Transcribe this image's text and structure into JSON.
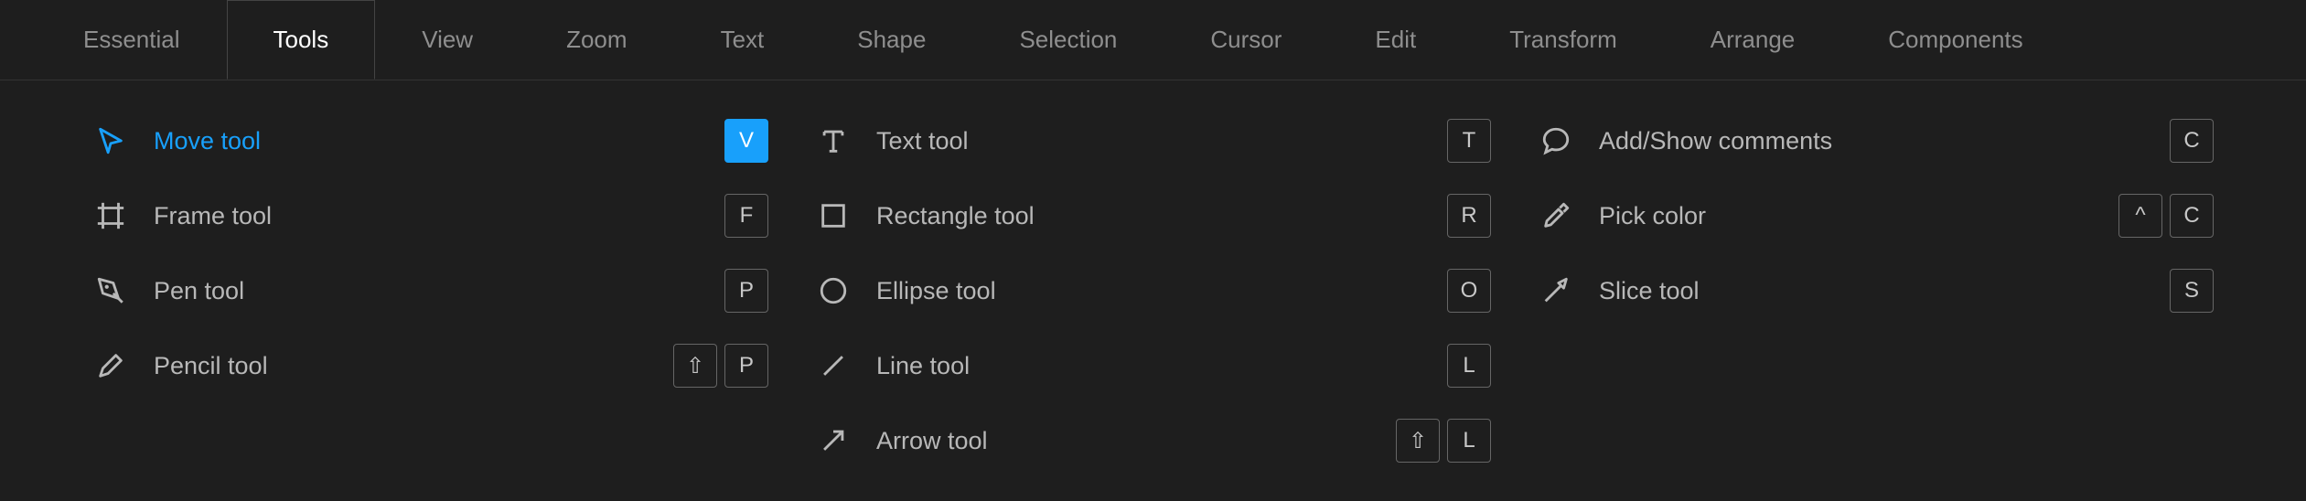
{
  "tabs": [
    {
      "label": "Essential",
      "active": false
    },
    {
      "label": "Tools",
      "active": true
    },
    {
      "label": "View",
      "active": false
    },
    {
      "label": "Zoom",
      "active": false
    },
    {
      "label": "Text",
      "active": false
    },
    {
      "label": "Shape",
      "active": false
    },
    {
      "label": "Selection",
      "active": false
    },
    {
      "label": "Cursor",
      "active": false
    },
    {
      "label": "Edit",
      "active": false
    },
    {
      "label": "Transform",
      "active": false
    },
    {
      "label": "Arrange",
      "active": false
    },
    {
      "label": "Components",
      "active": false
    }
  ],
  "columns": [
    [
      {
        "icon": "move",
        "label": "Move tool",
        "selected": true,
        "keys": [
          {
            "k": "V",
            "active": true
          }
        ]
      },
      {
        "icon": "frame",
        "label": "Frame tool",
        "selected": false,
        "keys": [
          {
            "k": "F"
          }
        ]
      },
      {
        "icon": "pen",
        "label": "Pen tool",
        "selected": false,
        "keys": [
          {
            "k": "P"
          }
        ]
      },
      {
        "icon": "pencil",
        "label": "Pencil tool",
        "selected": false,
        "keys": [
          {
            "k": "⇧"
          },
          {
            "k": "P"
          }
        ]
      }
    ],
    [
      {
        "icon": "text",
        "label": "Text tool",
        "selected": false,
        "keys": [
          {
            "k": "T"
          }
        ]
      },
      {
        "icon": "rectangle",
        "label": "Rectangle tool",
        "selected": false,
        "keys": [
          {
            "k": "R"
          }
        ]
      },
      {
        "icon": "ellipse",
        "label": "Ellipse tool",
        "selected": false,
        "keys": [
          {
            "k": "O"
          }
        ]
      },
      {
        "icon": "line",
        "label": "Line tool",
        "selected": false,
        "keys": [
          {
            "k": "L"
          }
        ]
      },
      {
        "icon": "arrow",
        "label": "Arrow tool",
        "selected": false,
        "keys": [
          {
            "k": "⇧"
          },
          {
            "k": "L"
          }
        ]
      }
    ],
    [
      {
        "icon": "comment",
        "label": "Add/Show comments",
        "selected": false,
        "keys": [
          {
            "k": "C"
          }
        ]
      },
      {
        "icon": "eyedropper",
        "label": "Pick color",
        "selected": false,
        "keys": [
          {
            "k": "^"
          },
          {
            "k": "C"
          }
        ]
      },
      {
        "icon": "slice",
        "label": "Slice tool",
        "selected": false,
        "keys": [
          {
            "k": "S"
          }
        ]
      }
    ]
  ]
}
